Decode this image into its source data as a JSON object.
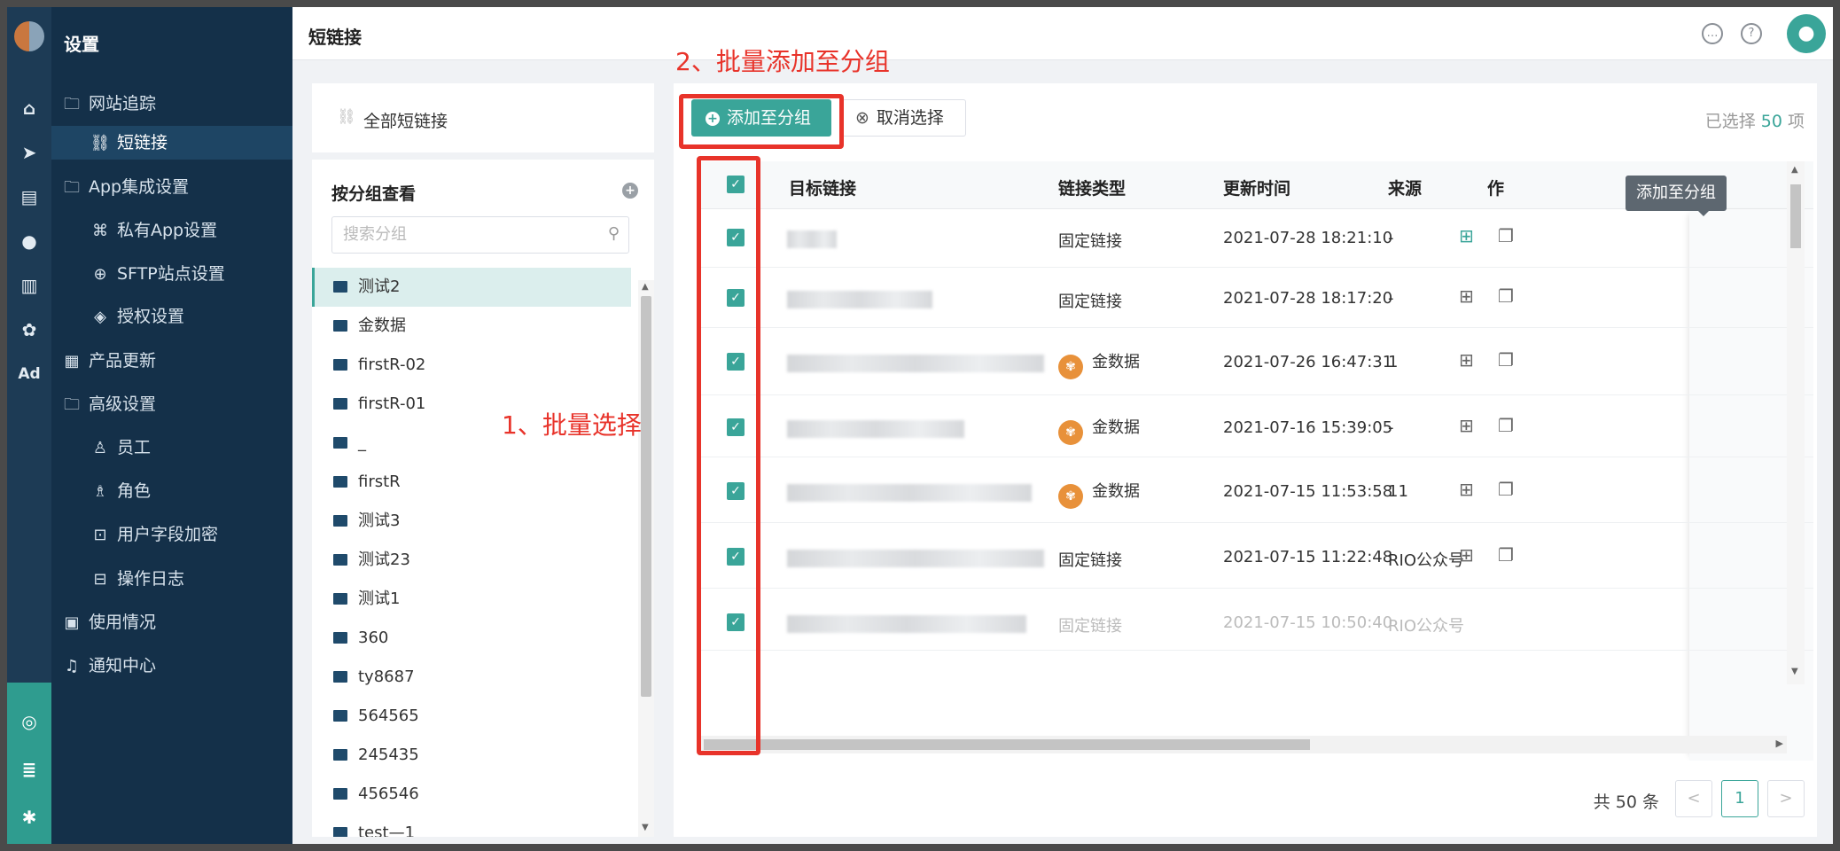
{
  "rail": {
    "icons": [
      "home-icon",
      "send-icon",
      "layout-icon",
      "user-icon",
      "bar-chart-icon",
      "wechat-icon",
      "ad-icon"
    ],
    "ad_label": "Ad"
  },
  "nav": {
    "title": "设置",
    "items": [
      {
        "label": "网站追踪",
        "icon": "folder-icon",
        "level": 0
      },
      {
        "label": "短链接",
        "icon": "link-icon",
        "level": 1,
        "active": true
      },
      {
        "label": "App集成设置",
        "icon": "folder-icon",
        "level": 0
      },
      {
        "label": "私有App设置",
        "icon": "command-icon",
        "level": 1
      },
      {
        "label": "SFTP站点设置",
        "icon": "globe-icon",
        "level": 1
      },
      {
        "label": "授权设置",
        "icon": "shield-icon",
        "level": 1
      },
      {
        "label": "产品更新",
        "icon": "grid-icon",
        "level": 0
      },
      {
        "label": "高级设置",
        "icon": "folder-icon",
        "level": 0
      },
      {
        "label": "员工",
        "icon": "person-icon",
        "level": 1
      },
      {
        "label": "角色",
        "icon": "role-icon",
        "level": 1
      },
      {
        "label": "用户字段加密",
        "icon": "encrypt-icon",
        "level": 1
      },
      {
        "label": "操作日志",
        "icon": "log-icon",
        "level": 1
      },
      {
        "label": "使用情况",
        "icon": "usage-icon",
        "level": 0
      },
      {
        "label": "通知中心",
        "icon": "bell-icon",
        "level": 0
      }
    ]
  },
  "header": {
    "title": "短链接"
  },
  "groups": {
    "all_label": "全部短链接",
    "section_title": "按分组查看",
    "search_placeholder": "搜索分组",
    "items": [
      "测试2",
      "金数据",
      "firstR-02",
      "firstR-01",
      "_",
      "firstR",
      "测试3",
      "测试23",
      "测试1",
      "360",
      "ty8687",
      "564565",
      "245435",
      "456546",
      "test—1"
    ]
  },
  "toolbar": {
    "add_label": "添加至分组",
    "cancel_label": "取消选择",
    "selected_prefix": "已选择",
    "selected_count": "50",
    "selected_suffix": "项"
  },
  "table": {
    "headers": {
      "link": "目标链接",
      "type": "链接类型",
      "time": "更新时间",
      "source": "来源",
      "ops": "作"
    },
    "rows": [
      {
        "type": "固定链接",
        "time": "2021-07-28 18:21:10",
        "source": "-",
        "badge": false
      },
      {
        "type": "固定链接",
        "time": "2021-07-28 18:17:20",
        "source": "-",
        "badge": false
      },
      {
        "type": "金数据",
        "time": "2021-07-26 16:47:31",
        "source": "1",
        "badge": true
      },
      {
        "type": "金数据",
        "time": "2021-07-16 15:39:05",
        "source": "-",
        "badge": true
      },
      {
        "type": "金数据",
        "time": "2021-07-15 11:53:58",
        "source": "11",
        "badge": true
      },
      {
        "type": "固定链接",
        "time": "2021-07-15 11:22:48",
        "source": "RIO公众号",
        "badge": false
      },
      {
        "type": "固定链接",
        "time": "2021-07-15 10:50:40",
        "source": "RIO公众号",
        "badge": false
      }
    ]
  },
  "tooltip": "添加至分组",
  "pagination": {
    "total": "共 50 条",
    "current": "1",
    "prev": "<",
    "next": ">"
  },
  "annotations": {
    "step1": "1、批量选择",
    "step2": "2、批量添加至分组"
  },
  "colors": {
    "accent": "#3aa599",
    "annotation": "#e8332a",
    "nav_bg": "#143049"
  }
}
